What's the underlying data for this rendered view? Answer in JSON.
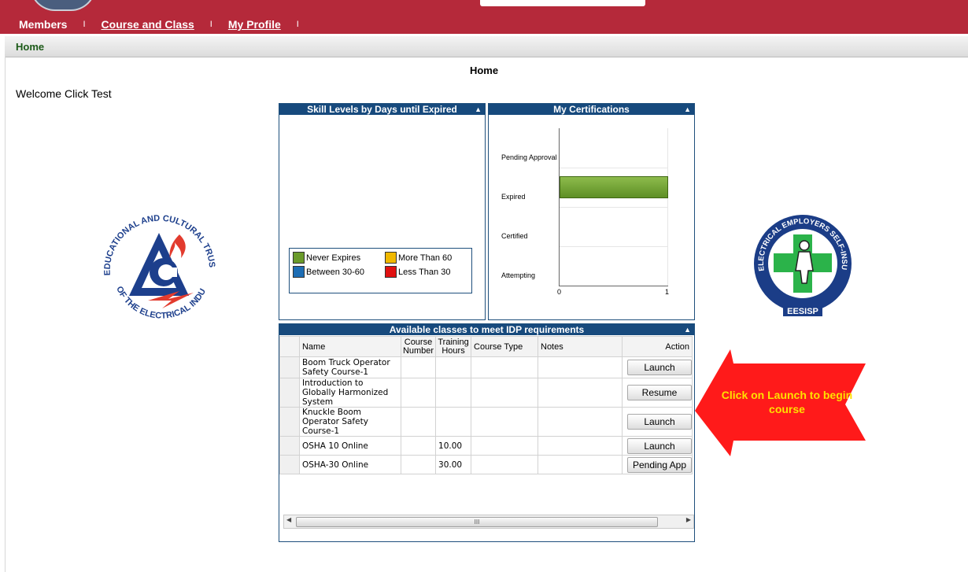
{
  "nav": {
    "items": [
      {
        "label": "Members"
      },
      {
        "label": "Course and Class"
      },
      {
        "label": "My Profile"
      }
    ],
    "separator": "I"
  },
  "breadcrumb": "Home",
  "page_title": "Home",
  "welcome": "Welcome Click Test",
  "skill_panel": {
    "title": "Skill Levels by Days until Expired",
    "legend": [
      {
        "label": "Never Expires",
        "color": "#6a9a2a"
      },
      {
        "label": "More Than 60",
        "color": "#f0b800"
      },
      {
        "label": "Between 30-60",
        "color": "#1d6db4"
      },
      {
        "label": "Less Than 30",
        "color": "#e01010"
      }
    ]
  },
  "cert_panel": {
    "title": "My Certifications",
    "chart_data": {
      "type": "bar",
      "orientation": "horizontal",
      "categories": [
        "Pending Approval",
        "Expired",
        "Certified",
        "Attempting"
      ],
      "values": [
        0,
        1,
        0,
        0
      ],
      "xlim": [
        0,
        1
      ],
      "xticks": [
        "0",
        "1"
      ],
      "bar_color": "#5e8f25"
    }
  },
  "classes_panel": {
    "title": "Available classes to meet IDP requirements",
    "columns": {
      "name": "Name",
      "course_number": "Course Number",
      "training_hours": "Training Hours",
      "course_type": "Course Type",
      "notes": "Notes",
      "action": "Action"
    },
    "rows": [
      {
        "name": "Boom Truck Operator Safety Course-1",
        "course_number": "",
        "hours": "",
        "type": "",
        "notes": "",
        "action": "Launch"
      },
      {
        "name": "Introduction to Globally Harmonized System",
        "course_number": "",
        "hours": "",
        "type": "",
        "notes": "",
        "action": "Resume"
      },
      {
        "name": "Knuckle Boom Operator Safety Course-1",
        "course_number": "",
        "hours": "",
        "type": "",
        "notes": "",
        "action": "Launch"
      },
      {
        "name": "OSHA 10 Online",
        "course_number": "",
        "hours": "10.00",
        "type": "",
        "notes": "",
        "action": "Launch"
      },
      {
        "name": "OSHA-30 Online",
        "course_number": "",
        "hours": "30.00",
        "type": "",
        "notes": "",
        "action": "Pending App"
      }
    ],
    "scroll_grip": "III"
  },
  "callout": {
    "text": "Click on Launch to begin course",
    "color": "#ff1a1a",
    "text_color": "#ffe000"
  },
  "logos": {
    "left": {
      "ring_text": "EDUCATIONAL AND CULTURAL TRUST FUND",
      "bottom_text": "OF THE ELECTRICAL INDUSTRY"
    },
    "right": {
      "ring_text": "ELECTRICAL EMPLOYERS SELF-INSURANCE SAFETY PLAN",
      "badge": "EESISP"
    }
  }
}
